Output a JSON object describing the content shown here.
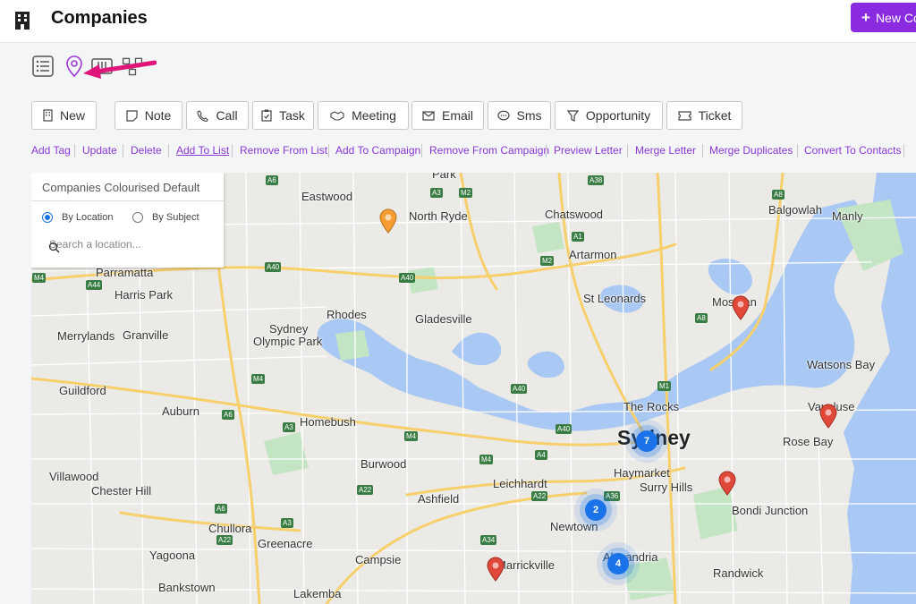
{
  "header": {
    "title": "Companies",
    "new_button": "New Co"
  },
  "actions": {
    "new": "New",
    "note": "Note",
    "call": "Call",
    "task": "Task",
    "meeting": "Meeting",
    "email": "Email",
    "sms": "Sms",
    "opportunity": "Opportunity",
    "ticket": "Ticket"
  },
  "links": {
    "add_tag": "Add Tag",
    "update": "Update",
    "delete": "Delete",
    "add_to_list": "Add To List",
    "remove_from_list": "Remove From List",
    "add_to_campaign": "Add To Campaign",
    "remove_from_campaign": "Remove From Campaign",
    "preview_letter": "Preview Letter",
    "merge_letter": "Merge Letter",
    "merge_duplicates": "Merge Duplicates",
    "convert_to_contacts": "Convert To Contacts"
  },
  "filter": {
    "title": "Companies Colourised Default",
    "by_location": "By Location",
    "by_subject": "By Subject",
    "search_placeholder": "Search a location..."
  },
  "map": {
    "places": {
      "park": "Park",
      "eastwood": "Eastwood",
      "north_ryde": "North Ryde",
      "chatswood": "Chatswood",
      "balgowlah": "Balgowlah",
      "manly": "Manly",
      "parramatta": "Parramatta",
      "artarmon": "Artarmon",
      "harris_park": "Harris Park",
      "st_leonards": "St Leonards",
      "mosman": "Mosman",
      "rhodes": "Rhodes",
      "gladesville": "Gladesville",
      "sydney_olympic_park_1": "Sydney",
      "sydney_olympic_park_2": "Olympic Park",
      "merrylands": "Merrylands",
      "granville": "Granville",
      "watsons_bay": "Watsons Bay",
      "guildford": "Guildford",
      "auburn": "Auburn",
      "the_rocks": "The Rocks",
      "homebush": "Homebush",
      "vaucluse": "Vaucluse",
      "sydney": "Sydney",
      "rose_bay": "Rose Bay",
      "burwood": "Burwood",
      "haymarket": "Haymarket",
      "surry_hills": "Surry Hills",
      "villawood": "Villawood",
      "leichhardt": "Leichhardt",
      "chester_hill": "Chester Hill",
      "ashfield": "Ashfield",
      "bondi_junction": "Bondi Junction",
      "newtown": "Newtown",
      "chullora": "Chullora",
      "greenacre": "Greenacre",
      "yagoona": "Yagoona",
      "campsie": "Campsie",
      "marrickville": "Marrickville",
      "alexandria": "Alexandria",
      "randwick": "Randwick",
      "bankstown": "Bankstown",
      "lakemba": "Lakemba"
    },
    "shields": [
      "A6",
      "A3",
      "M2",
      "A38",
      "A8",
      "A1",
      "M2",
      "A40",
      "A40",
      "A44",
      "M4",
      "M4",
      "A40",
      "A6",
      "A3",
      "A8",
      "M1",
      "A40",
      "A4",
      "M4",
      "A22",
      "A22",
      "A36",
      "A6",
      "A3",
      "A22",
      "A34",
      "M4"
    ],
    "clusters": {
      "c1": "7",
      "c2": "2",
      "c3": "4"
    },
    "colors": {
      "water": "#a9c9f4",
      "land": "#eceae6",
      "park": "#c4e5c3",
      "major_road": "#f7cf6b",
      "pin_red": "#e0493a",
      "pin_orange": "#f59d32",
      "cluster_blue": "#1a73e8",
      "accent": "#8a2be2"
    }
  }
}
